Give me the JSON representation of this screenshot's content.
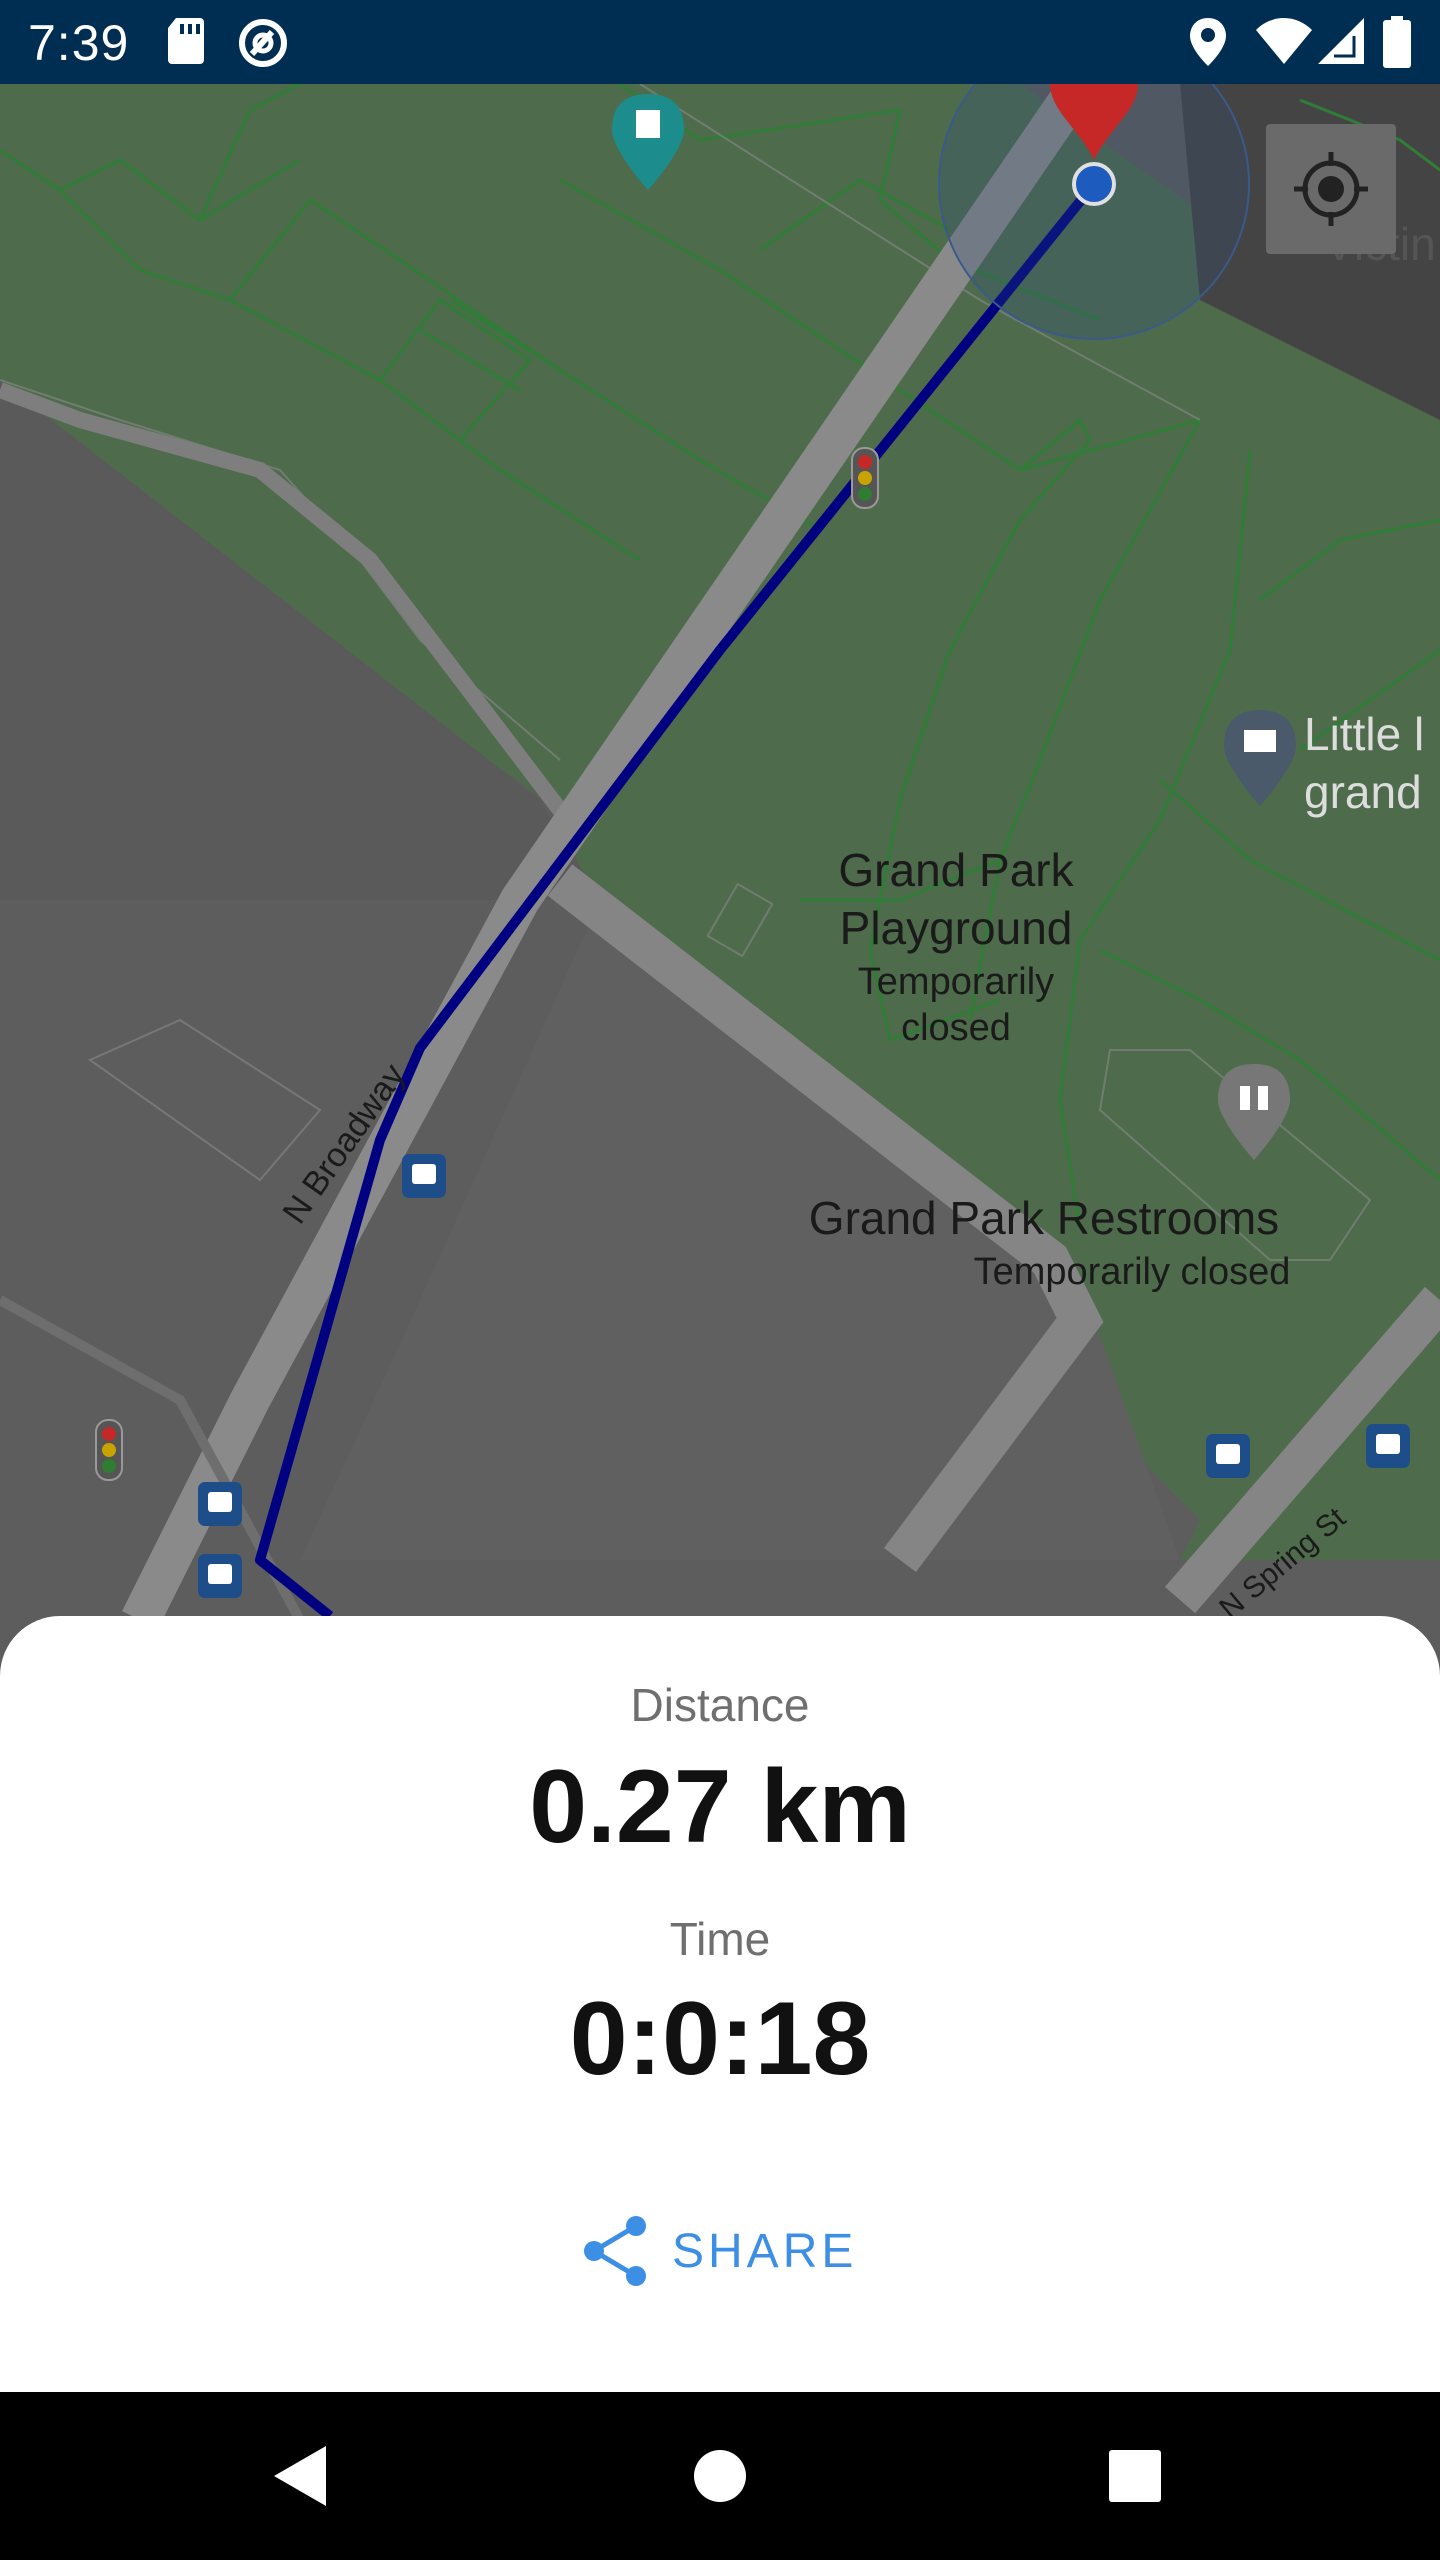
{
  "status_bar": {
    "time": "7:39",
    "icons": [
      "sd-card-icon",
      "sync-icon",
      "location-icon",
      "wifi-icon",
      "signal-icon",
      "battery-icon"
    ]
  },
  "map": {
    "labels": {
      "street_broadway": "N Broadway",
      "street_spring": "N Spring St",
      "victim_partial": "Victin",
      "little_line1": "Little l",
      "little_line2": "grand",
      "playground_line1": "Grand Park",
      "playground_line2": "Playground",
      "playground_status_line1": "Temporarily",
      "playground_status_line2": "closed",
      "restrooms": "Grand Park Restrooms",
      "restrooms_status": "Temporarily closed"
    },
    "colors": {
      "route": "#000080",
      "park": "#4e6b4c",
      "park_path": "#2f7d36",
      "road": "#858585",
      "ground": "#5d5d5d",
      "destination_pin": "#c62828",
      "current_location": "#1e5bbf"
    }
  },
  "summary": {
    "distance_label": "Distance",
    "distance_value": "0.27 km",
    "time_label": "Time",
    "time_value": "0:0:18",
    "share_label": "SHARE",
    "accent_color": "#3d8fe6"
  },
  "nav_bar": {
    "back": "back-icon",
    "home": "home-icon",
    "recents": "recents-icon"
  }
}
